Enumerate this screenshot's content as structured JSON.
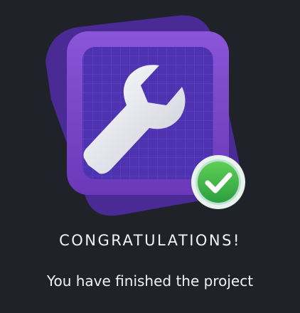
{
  "completion": {
    "title": "CONGRATULATIONS!",
    "message": "You have finished the project",
    "badge_icon": "wrench-icon",
    "status_icon": "checkmark-icon"
  },
  "colors": {
    "background": "#1f2228",
    "badge_purple": "#7a45c4",
    "badge_shadow": "#4b2a94",
    "success_green": "#3bb84a"
  }
}
